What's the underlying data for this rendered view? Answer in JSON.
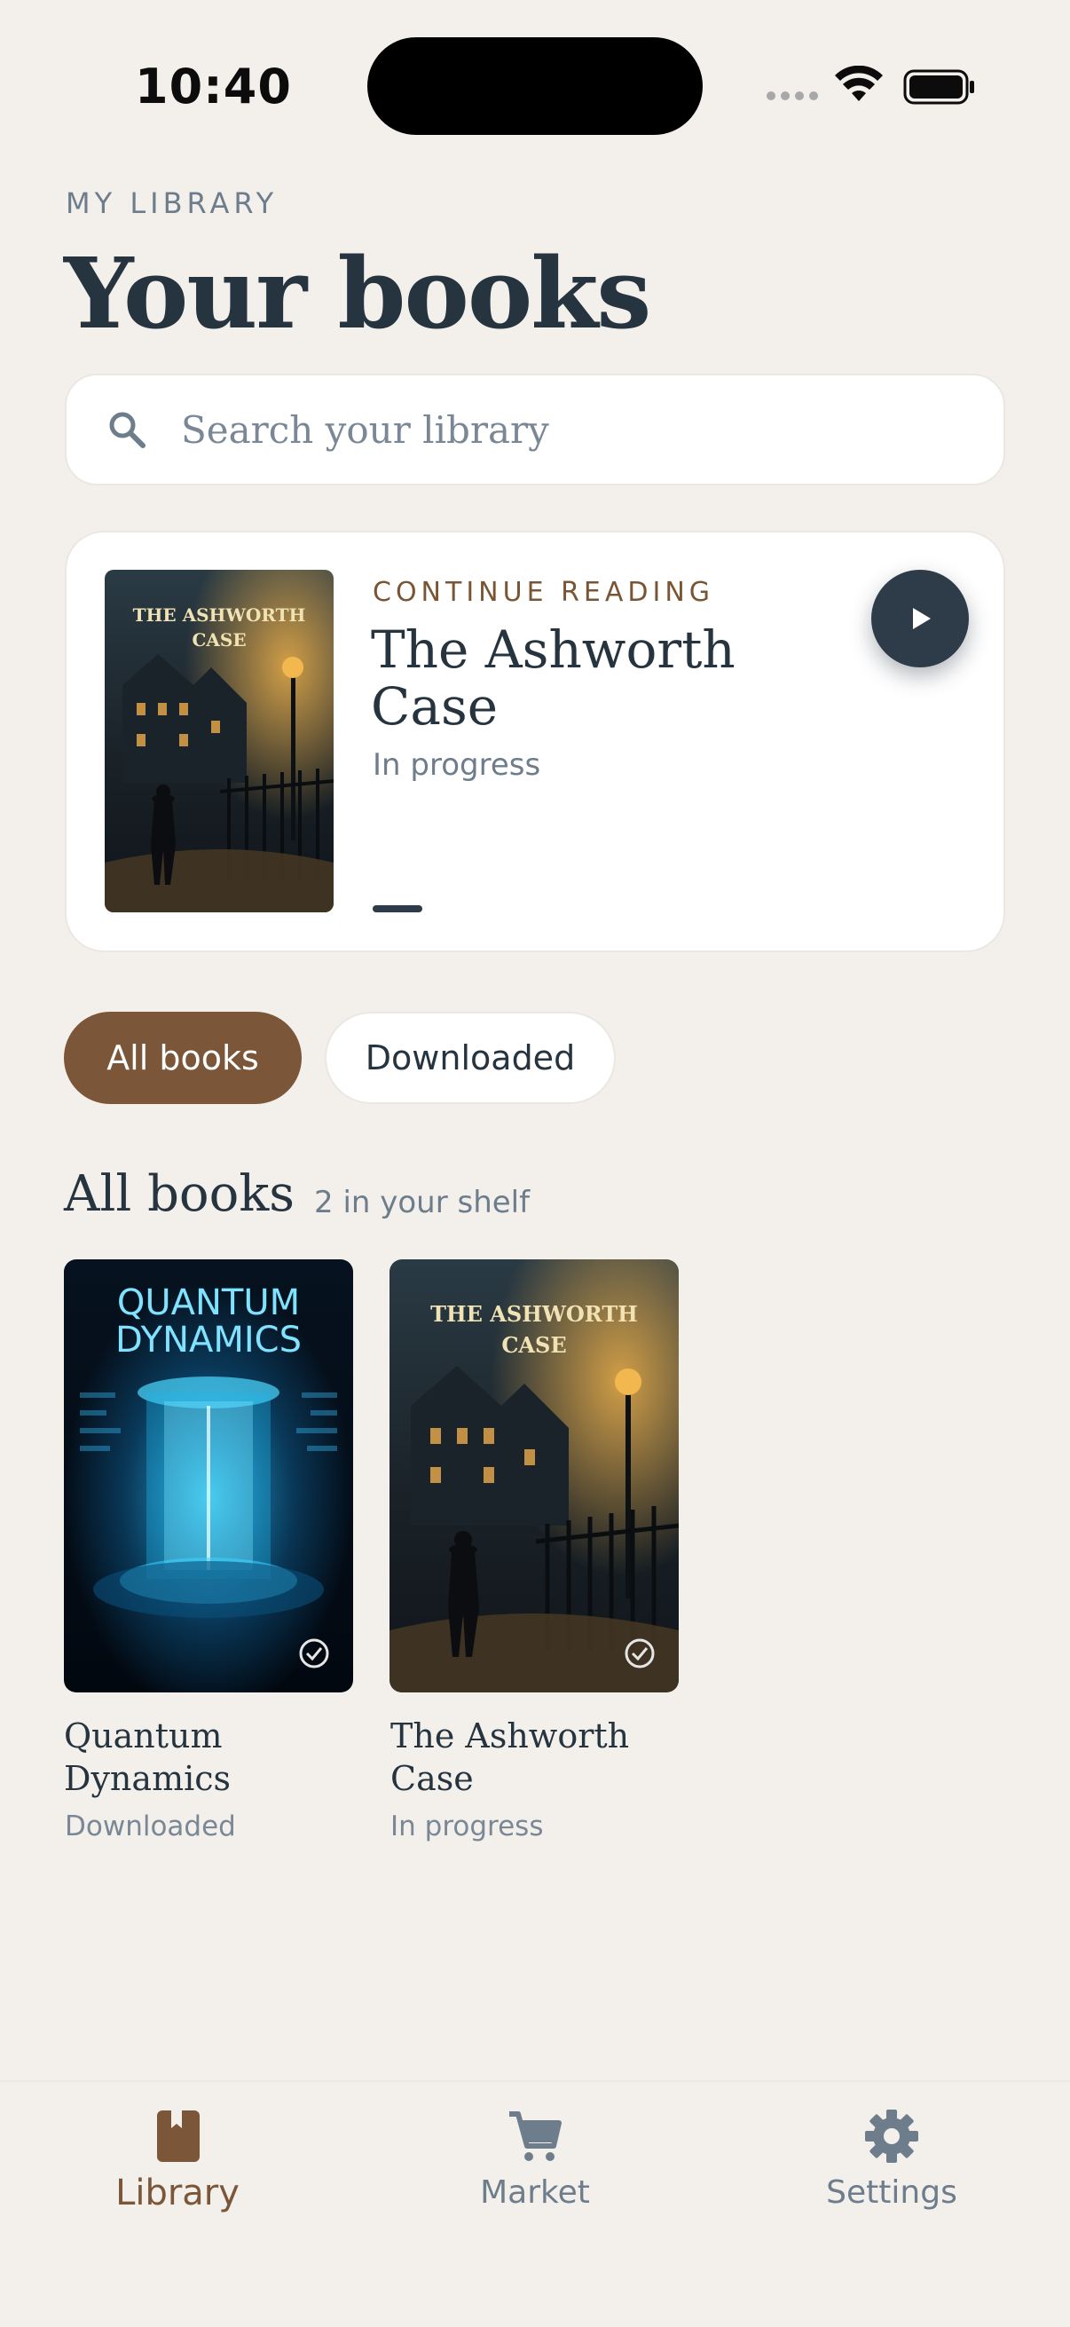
{
  "status_bar": {
    "time": "10:40"
  },
  "header": {
    "eyebrow": "MY LIBRARY",
    "title": "Your books"
  },
  "search": {
    "placeholder": "Search your library",
    "value": ""
  },
  "continue_reading": {
    "label": "CONTINUE READING",
    "title": "The Ashworth Case",
    "status": "In progress",
    "cover_text": "THE ASHWORTH CASE"
  },
  "filters": {
    "all": "All books",
    "downloaded": "Downloaded",
    "selected": "All books"
  },
  "section": {
    "title": "All books",
    "count": "2 in your shelf"
  },
  "books": [
    {
      "title": "Quantum Dynamics",
      "status": "Downloaded",
      "cover_text_1": "QUANTUM",
      "cover_text_2": "DYNAMICS"
    },
    {
      "title": "The Ashworth Case",
      "status": "In progress",
      "cover_text_1": "THE ASHWORTH",
      "cover_text_2": "CASE"
    }
  ],
  "nav": {
    "library": "Library",
    "market": "Market",
    "settings": "Settings",
    "active": "Library"
  },
  "colors": {
    "accent": "#7b5638",
    "ink": "#26343f",
    "muted": "#6e7d8c",
    "background": "#f3f0ec",
    "card": "#ffffff"
  },
  "icons": [
    "search-icon",
    "play-icon",
    "check-badge-icon",
    "book-icon",
    "cart-icon",
    "gear-icon",
    "wifi-icon",
    "battery-icon"
  ]
}
